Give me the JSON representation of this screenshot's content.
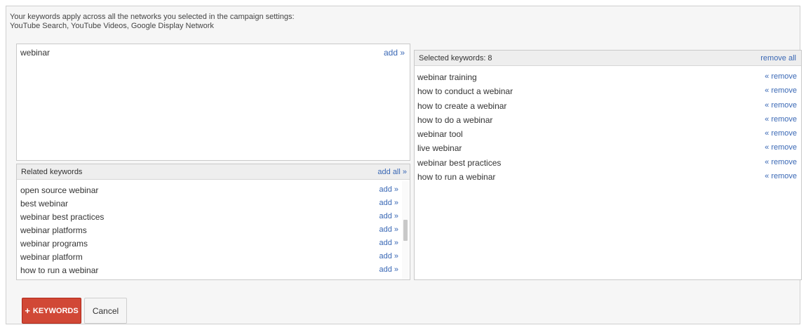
{
  "intro": {
    "line1": "Your keywords apply across all the networks you selected in the campaign settings:",
    "line2": "YouTube Search, YouTube Videos, Google Display Network"
  },
  "input": {
    "value": "webinar",
    "add_label": "add »"
  },
  "related": {
    "title": "Related keywords",
    "add_all_label": "add all »",
    "items": [
      {
        "label": "open source webinar",
        "action": "add »"
      },
      {
        "label": "best webinar",
        "action": "add »"
      },
      {
        "label": "webinar best practices",
        "action": "add »"
      },
      {
        "label": "webinar platforms",
        "action": "add »"
      },
      {
        "label": "webinar programs",
        "action": "add »"
      },
      {
        "label": "webinar platform",
        "action": "add »"
      },
      {
        "label": "how to run a webinar",
        "action": "add »"
      }
    ]
  },
  "selected": {
    "title": "Selected keywords: 8",
    "remove_all_label": "remove all",
    "items": [
      {
        "label": "webinar training",
        "action": "« remove"
      },
      {
        "label": "how to conduct a webinar",
        "action": "« remove"
      },
      {
        "label": "how to create a webinar",
        "action": "« remove"
      },
      {
        "label": "how to do a webinar",
        "action": "« remove"
      },
      {
        "label": "webinar tool",
        "action": "« remove"
      },
      {
        "label": "live webinar",
        "action": "« remove"
      },
      {
        "label": "webinar best practices",
        "action": "« remove"
      },
      {
        "label": "how to run a webinar",
        "action": "« remove"
      }
    ]
  },
  "buttons": {
    "keywords_icon": "+",
    "keywords_label": "KEYWORDS",
    "cancel_label": "Cancel"
  },
  "colors": {
    "accent": "#d14836",
    "link": "#3a68b5"
  }
}
